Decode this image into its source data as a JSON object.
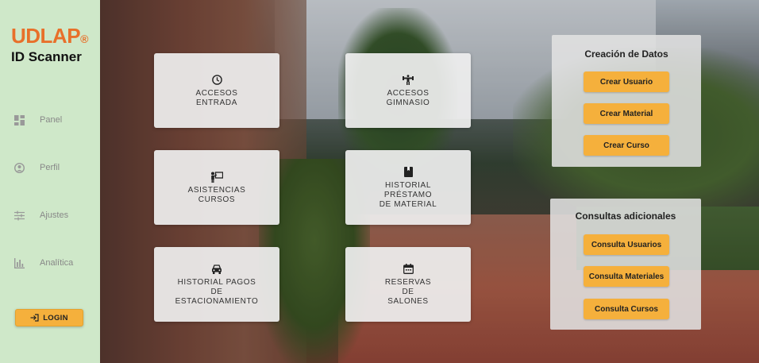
{
  "brand": {
    "logo": "UDLAP",
    "app_title": "ID Scanner",
    "accent": "#e8702a"
  },
  "sidebar": {
    "items": [
      {
        "label": "Panel",
        "icon": "dashboard-icon"
      },
      {
        "label": "Perfil",
        "icon": "account-icon"
      },
      {
        "label": "Ajustes",
        "icon": "sliders-icon"
      },
      {
        "label": "Analítica",
        "icon": "bar-chart-icon"
      }
    ],
    "login_label": "LOGIN"
  },
  "cards": [
    {
      "label": "ACCESOS\nENTRADA",
      "icon": "clock-icon"
    },
    {
      "label": "ACCESOS\nGIMNASIO",
      "icon": "fitness-icon"
    },
    {
      "label": "ASISTENCIAS\nCURSOS",
      "icon": "teacher-icon"
    },
    {
      "label": "HISTORIAL\nPRÉSTAMO\nDE MATERIAL",
      "icon": "book-icon"
    },
    {
      "label": "HISTORIAL PAGOS\nDE\nESTACIONAMIENTO",
      "icon": "car-icon"
    },
    {
      "label": "RESERVAS\nDE\nSALONES",
      "icon": "calendar-icon"
    }
  ],
  "panels": {
    "creation": {
      "title": "Creación de Datos",
      "buttons": [
        "Crear Usuario",
        "Crear Material",
        "Crear Curso"
      ]
    },
    "queries": {
      "title": "Consultas adicionales",
      "buttons": [
        "Consulta Usuarios",
        "Consulta Materiales",
        "Consulta Cursos"
      ]
    }
  },
  "colors": {
    "sidebar_bg": "#cfe8c9",
    "button": "#f5b03c"
  }
}
